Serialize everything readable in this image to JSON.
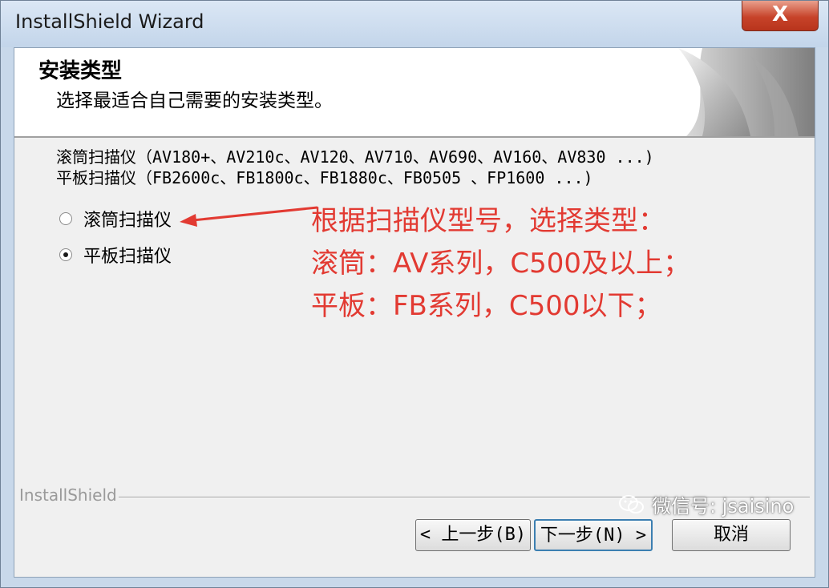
{
  "window": {
    "title": "InstallShield Wizard",
    "close_glyph": "X"
  },
  "header": {
    "title": "安装类型",
    "subtitle": "选择最适合自己需要的安装类型。"
  },
  "description": {
    "line1": "滚筒扫描仪（AV180+、AV210c、AV120、AV710、AV690、AV160、AV830 ...)",
    "line2": "平板扫描仪（FB2600c、FB1800c、FB1880c、FB0505 、FP1600 ...)"
  },
  "options": [
    {
      "label": "滚筒扫描仪",
      "checked": false
    },
    {
      "label": "平板扫描仪",
      "checked": true
    }
  ],
  "annotation": {
    "line1": "根据扫描仪型号，选择类型：",
    "line2": "滚筒：AV系列，C500及以上；",
    "line3": "平板：FB系列，C500以下；",
    "color": "#e23a32"
  },
  "footer": {
    "brand": "InstallShield",
    "back_label": "< 上一步(B)",
    "next_label": "下一步(N) >",
    "cancel_label": "取消"
  },
  "watermark": {
    "text": "微信号: jsaisino",
    "icon": "wechat-icon"
  }
}
